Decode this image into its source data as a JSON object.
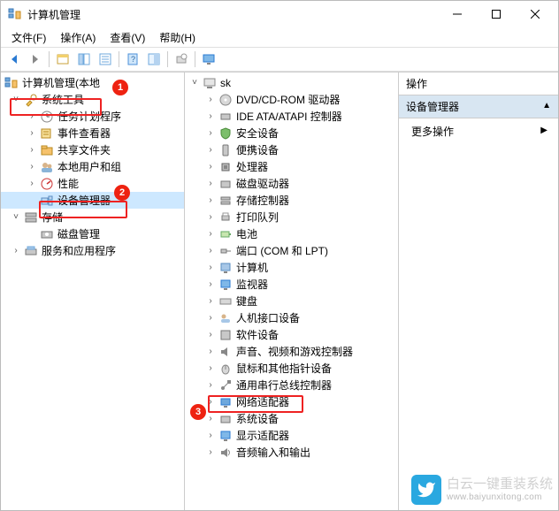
{
  "window": {
    "title": "计算机管理"
  },
  "menus": {
    "file": "文件(F)",
    "action": "操作(A)",
    "view": "查看(V)",
    "help": "帮助(H)"
  },
  "toolbar_icons": {
    "back": "back-icon",
    "forward": "forward-icon",
    "up": "up-icon",
    "folder": "folder-icon",
    "list": "list-icon",
    "details": "details-icon",
    "help": "help-icon",
    "properties": "properties-icon",
    "refresh": "refresh-icon",
    "display": "display-icon"
  },
  "left_tree": {
    "root": "计算机管理(本地",
    "sys_tools": "系统工具",
    "sys_tools_children": {
      "task_scheduler": "任务计划程序",
      "event_viewer": "事件查看器",
      "shared_folders": "共享文件夹",
      "local_users": "本地用户和组",
      "performance": "性能",
      "device_manager": "设备管理器"
    },
    "storage": "存储",
    "disk_mgmt": "磁盘管理",
    "services_apps": "服务和应用程序"
  },
  "device_root": "sk",
  "devices": {
    "dvd": "DVD/CD-ROM 驱动器",
    "ide": "IDE ATA/ATAPI 控制器",
    "security": "安全设备",
    "portable": "便携设备",
    "cpu": "处理器",
    "diskdrive": "磁盘驱动器",
    "storage_ctrl": "存储控制器",
    "print_queue": "打印队列",
    "battery": "电池",
    "ports": "端口 (COM 和 LPT)",
    "computer": "计算机",
    "monitor": "监视器",
    "keyboard": "键盘",
    "hid": "人机接口设备",
    "software": "软件设备",
    "sound": "声音、视频和游戏控制器",
    "mouse": "鼠标和其他指针设备",
    "usb": "通用串行总线控制器",
    "network": "网络适配器",
    "system": "系统设备",
    "display": "显示适配器",
    "audioio": "音频输入和输出"
  },
  "actions": {
    "header": "操作",
    "section": "设备管理器",
    "more": "更多操作"
  },
  "markers": {
    "1": "1",
    "2": "2",
    "3": "3"
  },
  "watermark": {
    "brand": "白云一键重装系统",
    "domain": "www.baiyunxitong.com"
  }
}
